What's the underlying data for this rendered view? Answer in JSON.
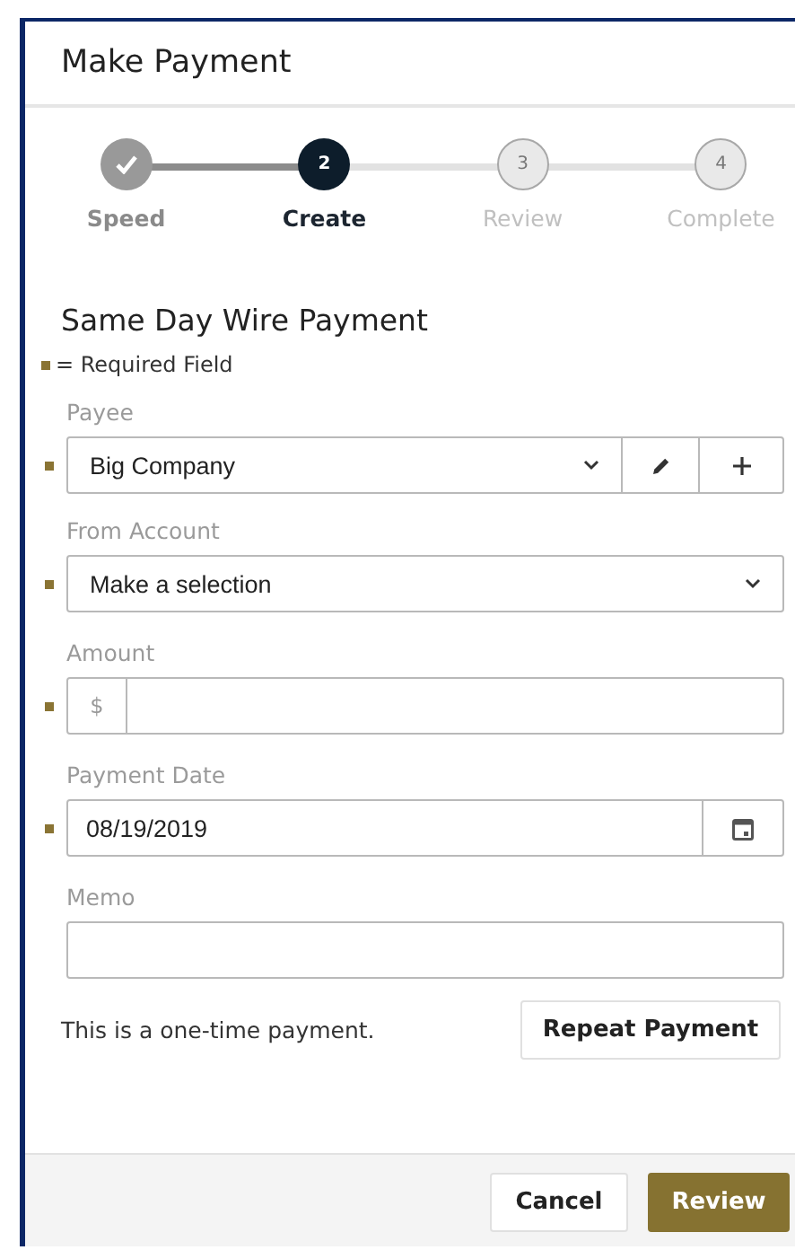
{
  "dialog": {
    "title": "Make Payment"
  },
  "steps": [
    {
      "label": "Speed",
      "completed": true,
      "selected": false
    },
    {
      "number": "2",
      "label": "Create",
      "completed": false,
      "selected": true
    },
    {
      "number": "3",
      "label": "Review",
      "completed": false,
      "selected": false
    },
    {
      "number": "4",
      "label": "Complete",
      "completed": false,
      "selected": false
    }
  ],
  "form": {
    "heading": "Same Day Wire Payment",
    "required_legend": "= Required Field",
    "fields": [
      {
        "kind": "select",
        "label": "Payee",
        "value": "Big Company",
        "required": true,
        "actions": [
          {
            "kind": "edit"
          },
          {
            "kind": "add"
          }
        ]
      },
      {
        "kind": "select",
        "label": "From Account",
        "value": "Make a selection",
        "required": true
      },
      {
        "kind": "currency",
        "label": "Amount",
        "prefix": "$",
        "required": true
      },
      {
        "kind": "date",
        "label": "Payment Date",
        "value": "08/19/2019",
        "required": true
      },
      {
        "kind": "text",
        "label": "Memo",
        "required": false
      }
    ],
    "recurrence_text": "This is a one-time payment.",
    "repeat_button": "Repeat Payment"
  },
  "footer": {
    "buttons": [
      {
        "kind": "secondary",
        "label": "Cancel"
      },
      {
        "kind": "primary",
        "label": "Review"
      }
    ]
  }
}
